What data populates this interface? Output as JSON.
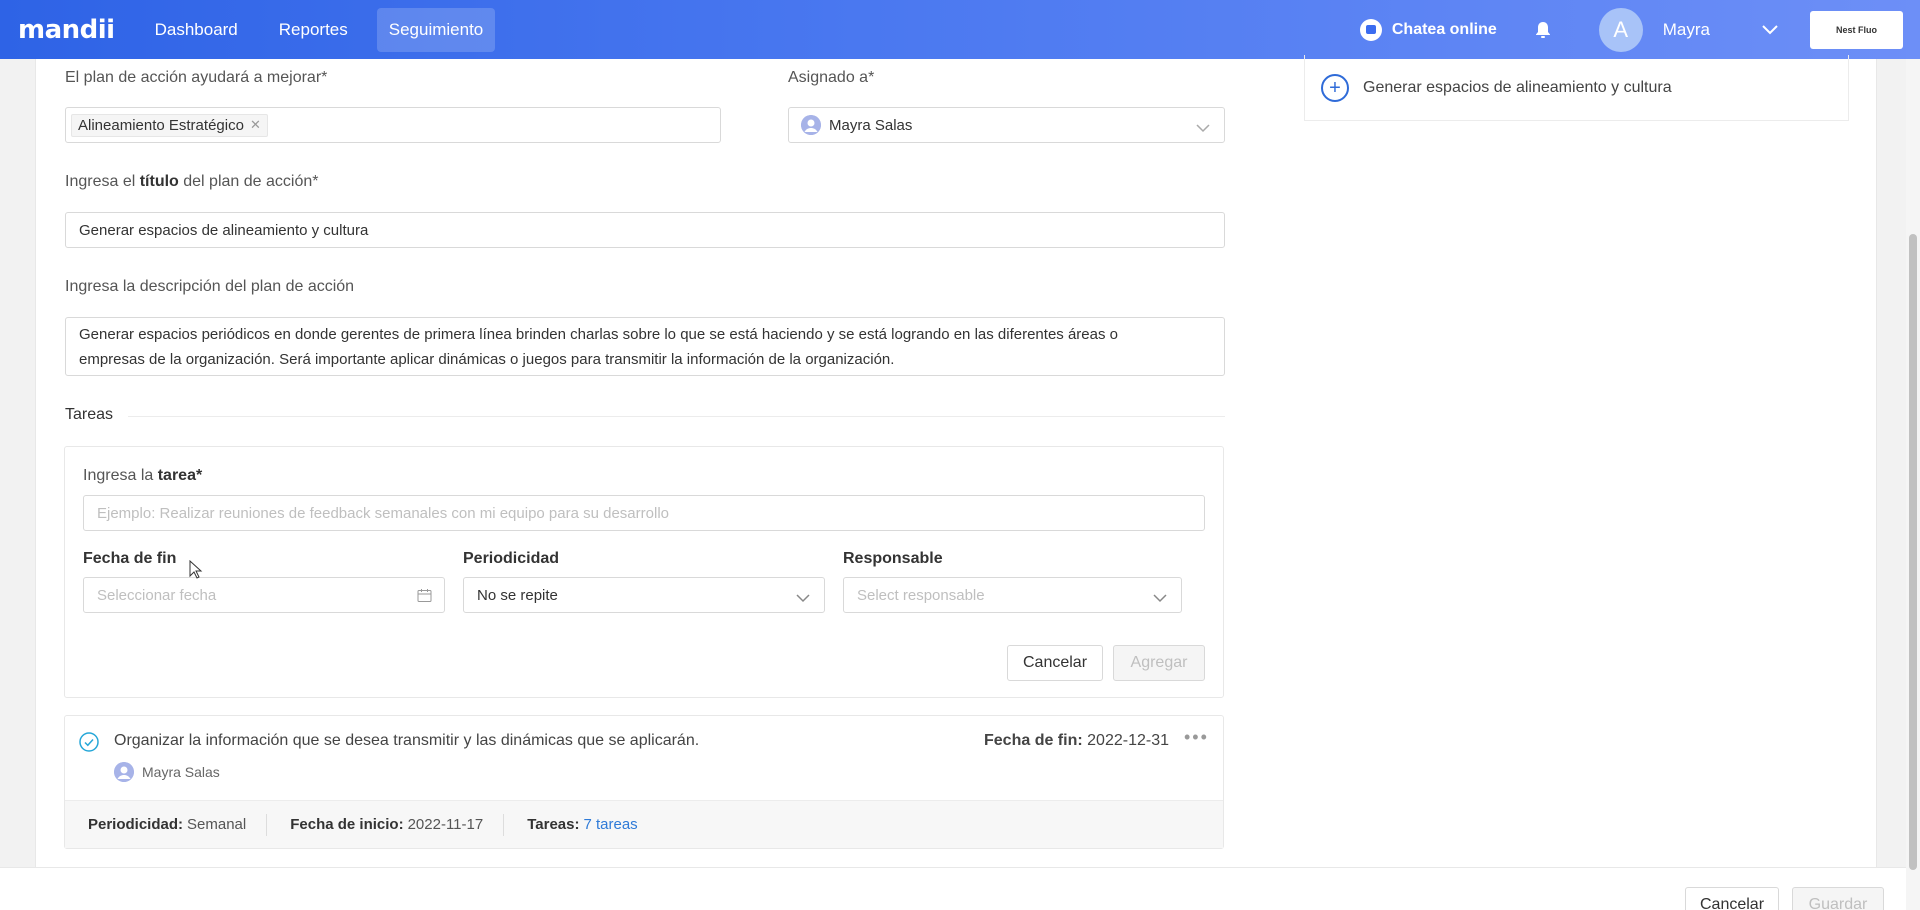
{
  "navbar": {
    "logo": "mandii",
    "items": [
      {
        "label": "Dashboard"
      },
      {
        "label": "Reportes"
      },
      {
        "label": "Seguimiento"
      }
    ],
    "chat_label": "Chatea online",
    "avatar_initial": "A",
    "username": "Mayra",
    "company_label": "Nest Fluo"
  },
  "form": {
    "improve_label": "El plan de acción ayudará a mejorar*",
    "improve_tag": "Alineamiento Estratégico",
    "assigned_label": "Asignado a*",
    "assigned_value": "Mayra Salas",
    "title_label_pre": "Ingresa el ",
    "title_label_bold": "título",
    "title_label_post": " del plan de acción*",
    "title_value": "Generar espacios de alineamiento y cultura",
    "desc_label": "Ingresa la descripción del plan de acción",
    "desc_line1": "Generar espacios periódicos en donde gerentes de primera línea brinden charlas sobre lo que se está haciendo y se está logrando en las diferentes áreas o",
    "desc_line2": "empresas de la organización. Será importante aplicar dinámicas o juegos para transmitir la información de la organización."
  },
  "side_card": {
    "item": "Generar espacios de alineamiento y cultura"
  },
  "tasks": {
    "section_title": "Tareas",
    "input_label_pre": "Ingresa la ",
    "input_label_bold": "tarea*",
    "input_placeholder": "Ejemplo: Realizar reuniones de feedback semanales con mi equipo para su desarrollo",
    "end_date_label": "Fecha de fin",
    "end_date_placeholder": "Seleccionar fecha",
    "periodicity_label": "Periodicidad",
    "periodicity_value": "No se repite",
    "responsible_label": "Responsable",
    "responsible_placeholder": "Select responsable",
    "cancel_label": "Cancelar",
    "add_label": "Agregar"
  },
  "task_item": {
    "text": "Organizar la información que se desea transmitir y las dinámicas que se aplicarán.",
    "end_label": "Fecha de fin:",
    "end_value": "2022-12-31",
    "assignee": "Mayra Salas",
    "periodicity_label": "Periodicidad:",
    "periodicity_value": "Semanal",
    "start_label": "Fecha de inicio:",
    "start_value": "2022-11-17",
    "tasks_label": "Tareas:",
    "tasks_value": "7 tareas"
  },
  "footer": {
    "cancel_label": "Cancelar",
    "save_label": "Guardar"
  },
  "colors": {
    "navbar_start": "#2e63e6",
    "navbar_end": "#6d8ff7",
    "accent": "#2f6bd8",
    "link": "#2f7bd8",
    "check": "#26a7d8"
  }
}
